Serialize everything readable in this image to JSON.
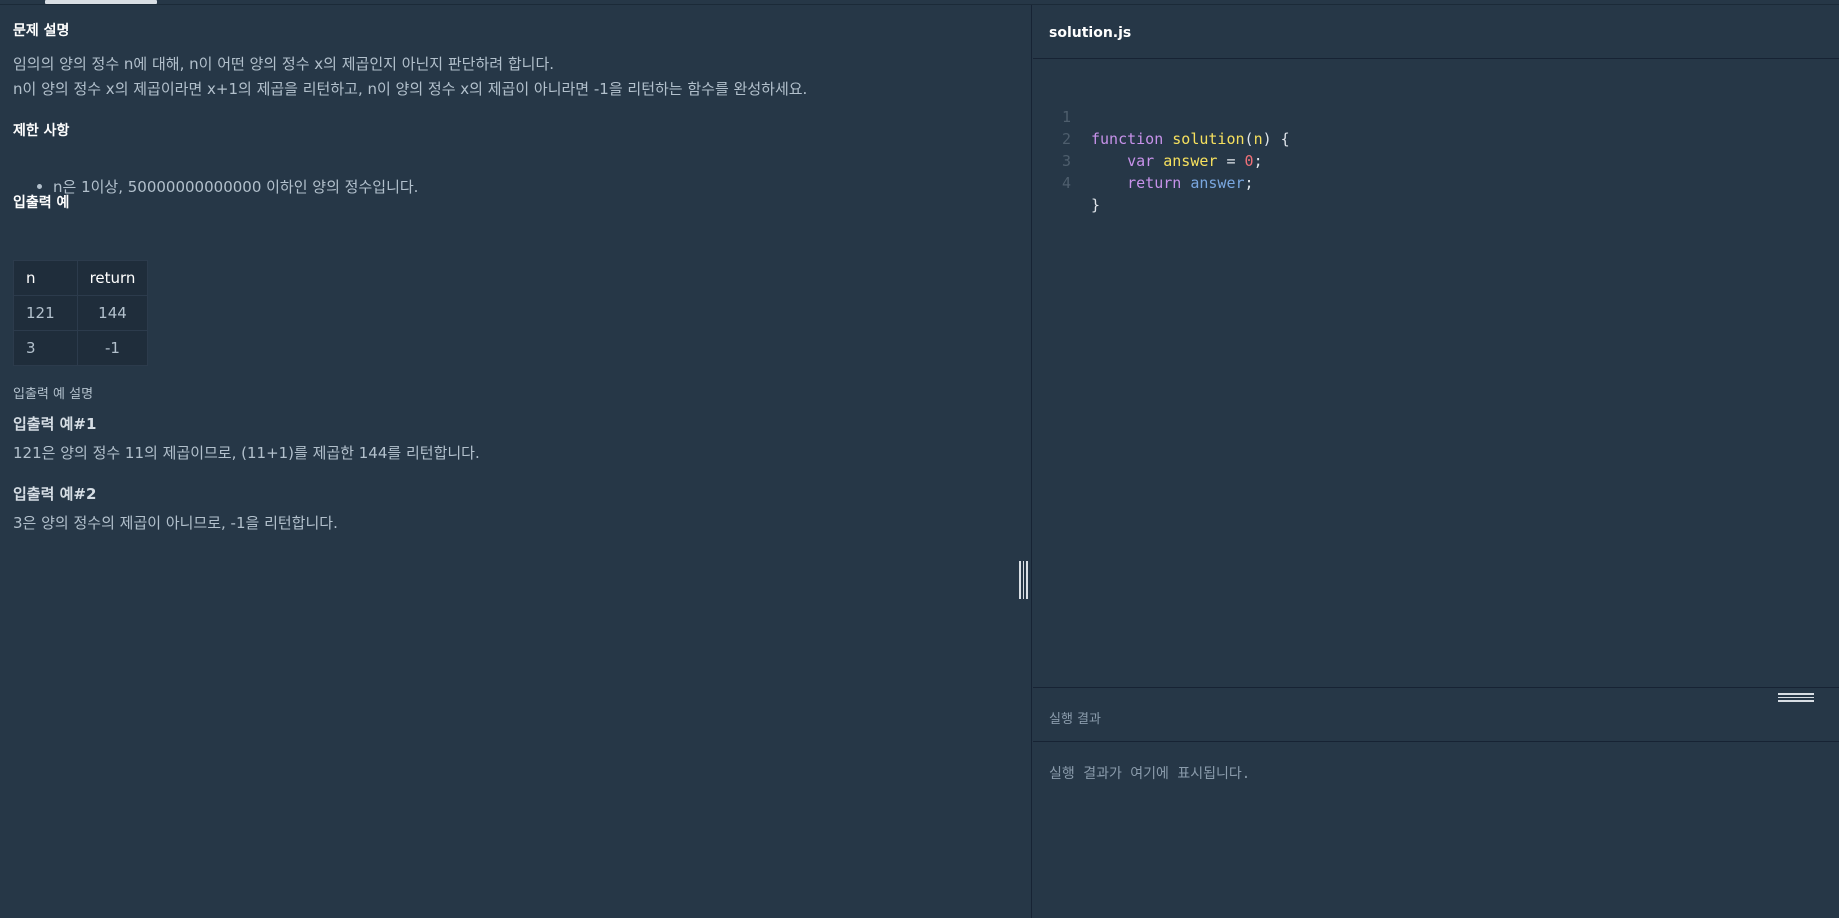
{
  "problem": {
    "section_title": "문제 설명",
    "description": [
      "임의의 양의 정수 n에 대해, n이 어떤 양의 정수 x의 제곱인지 아닌지 판단하려 합니다.",
      "n이 양의 정수 x의 제곱이라면 x+1의 제곱을 리턴하고, n이 양의 정수 x의 제곱이 아니라면 -1을 리턴하는 함수를 완성하세요."
    ],
    "constraints_title": "제한 사항",
    "constraints": [
      "n은 1이상, 50000000000000 이하인 양의 정수입니다."
    ],
    "io_title": "입출력 예",
    "io_table": {
      "headers": [
        "n",
        "return"
      ],
      "rows": [
        [
          "121",
          "144"
        ],
        [
          "3",
          "-1"
        ]
      ]
    },
    "io_explain_title": "입출력 예 설명",
    "examples": [
      {
        "title": "입출력 예#1",
        "text": "121은 양의 정수 11의 제곱이므로, (11+1)를 제곱한 144를 리턴합니다."
      },
      {
        "title": "입출력 예#2",
        "text": "3은 양의 정수의 제곱이 아니므로, -1을 리턴합니다."
      }
    ]
  },
  "editor": {
    "file_name": "solution.js",
    "lines": [
      {
        "number": "1",
        "tokens": {
          "kw": "function",
          "fn": "solution",
          "param": "n"
        }
      },
      {
        "number": "2",
        "tokens": {
          "kw": "var",
          "fn": "answer",
          "num": "0"
        }
      },
      {
        "number": "3",
        "tokens": {
          "kw": "return",
          "id": "answer"
        }
      },
      {
        "number": "4",
        "tokens": {
          "brace": "}"
        }
      }
    ]
  },
  "result": {
    "title": "실행 결과",
    "placeholder": "실행 결과가 여기에 표시됩니다."
  },
  "colors": {
    "background": "#263747",
    "keyword": "#c792ea",
    "function_name": "#f6e05e",
    "identifier": "#7aa7e0",
    "number": "#f07178"
  }
}
